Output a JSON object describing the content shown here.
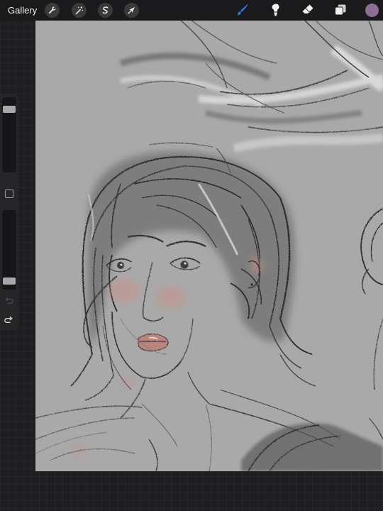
{
  "toolbar": {
    "gallery_label": "Gallery",
    "left_tools": [
      {
        "name": "actions-wrench-icon"
      },
      {
        "name": "adjustments-wand-icon"
      },
      {
        "name": "selection-s-icon"
      },
      {
        "name": "transform-arrow-icon"
      }
    ],
    "right_tools": [
      {
        "name": "brush-icon",
        "active": true
      },
      {
        "name": "smudge-icon",
        "active": false
      },
      {
        "name": "eraser-icon",
        "active": false
      },
      {
        "name": "layers-icon",
        "active": false
      }
    ],
    "active_color": "#8c6e96",
    "brush_active_color": "#2f6fd6"
  },
  "sidebar": {
    "brush_size_level": 0.88,
    "opacity_level": 0.06
  },
  "canvas": {
    "background": "#a9a9a9"
  }
}
